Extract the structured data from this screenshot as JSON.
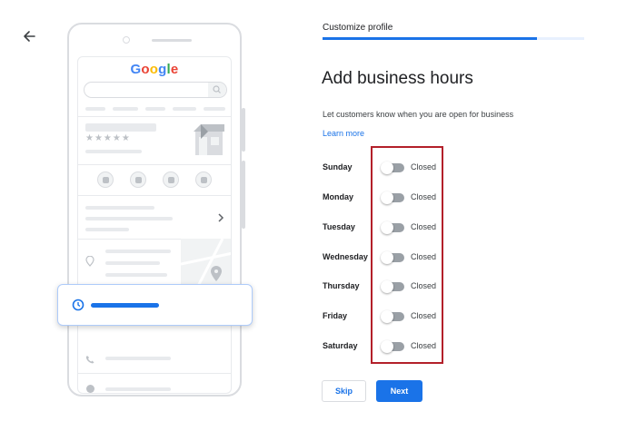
{
  "header": {
    "step_title": "Customize profile",
    "progress_fraction": 0.82
  },
  "main": {
    "title": "Add business hours",
    "description": "Let customers know when you are open for business",
    "learn_more": "Learn more"
  },
  "days": [
    {
      "name": "Sunday",
      "state": "Closed",
      "on": false
    },
    {
      "name": "Monday",
      "state": "Closed",
      "on": false
    },
    {
      "name": "Tuesday",
      "state": "Closed",
      "on": false
    },
    {
      "name": "Wednesday",
      "state": "Closed",
      "on": false
    },
    {
      "name": "Thursday",
      "state": "Closed",
      "on": false
    },
    {
      "name": "Friday",
      "state": "Closed",
      "on": false
    },
    {
      "name": "Saturday",
      "state": "Closed",
      "on": false
    }
  ],
  "actions": {
    "skip": "Skip",
    "next": "Next"
  },
  "illustration": {
    "logo_text": "Google",
    "rating_stars": "★★★★★"
  },
  "colors": {
    "accent": "#1a73e8",
    "highlight_border": "#b3202a",
    "toggle_off": "#9aa0a6"
  },
  "icons": [
    "back-arrow-icon",
    "search-icon",
    "phone-icon",
    "directions-icon",
    "bookmark-icon",
    "website-icon",
    "chevron-right-icon",
    "location-pin-icon",
    "clock-icon",
    "globe-icon",
    "storefront-icon"
  ]
}
